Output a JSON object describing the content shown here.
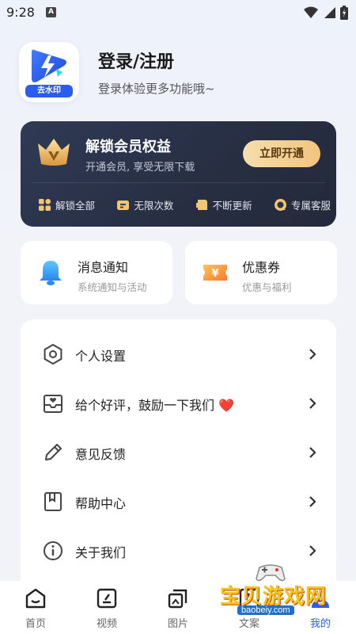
{
  "status_bar": {
    "time": "9:28",
    "notification_badge": "A",
    "icons": [
      "wifi-icon",
      "signal-icon",
      "battery-icon"
    ]
  },
  "profile": {
    "logo_label": "去水印",
    "title": "登录/注册",
    "subtitle": "登录体验更多功能哦~"
  },
  "vip": {
    "title": "解锁会员权益",
    "subtitle": "开通会员, 享受无限下载",
    "button_label": "立即开通",
    "perks": [
      {
        "label": "解锁全部",
        "icon": "grid-icon"
      },
      {
        "label": "无限次数",
        "icon": "ticket-icon"
      },
      {
        "label": "不断更新",
        "icon": "update-icon"
      },
      {
        "label": "专属客服",
        "icon": "chat-icon"
      }
    ]
  },
  "quick_cards": [
    {
      "title": "消息通知",
      "subtitle": "系统通知与活动",
      "icon": "bell-icon"
    },
    {
      "title": "优惠券",
      "subtitle": "优惠与福利",
      "icon": "coupon-icon"
    }
  ],
  "menu": {
    "items": [
      {
        "label": "个人设置",
        "icon": "settings-icon"
      },
      {
        "label": "给个好评，鼓励一下我们",
        "suffix": "❤️",
        "icon": "review-icon"
      },
      {
        "label": "意见反馈",
        "icon": "pencil-icon"
      },
      {
        "label": "帮助中心",
        "icon": "bookmark-icon"
      },
      {
        "label": "关于我们",
        "icon": "info-icon"
      }
    ]
  },
  "bottom_nav": {
    "items": [
      {
        "label": "首页",
        "icon": "home-icon",
        "active": false
      },
      {
        "label": "视频",
        "icon": "video-icon",
        "active": false
      },
      {
        "label": "图片",
        "icon": "image-icon",
        "active": false
      },
      {
        "label": "文案",
        "icon": "text-icon",
        "active": false
      },
      {
        "label": "我的",
        "icon": "user-icon",
        "active": true
      }
    ]
  },
  "watermark": {
    "text": "宝贝游戏网",
    "url": "baobeiy.com"
  },
  "colors": {
    "accent": "#2b5cf0",
    "vip_gold": "#f2c47c",
    "vip_bg": "#2a3248"
  }
}
